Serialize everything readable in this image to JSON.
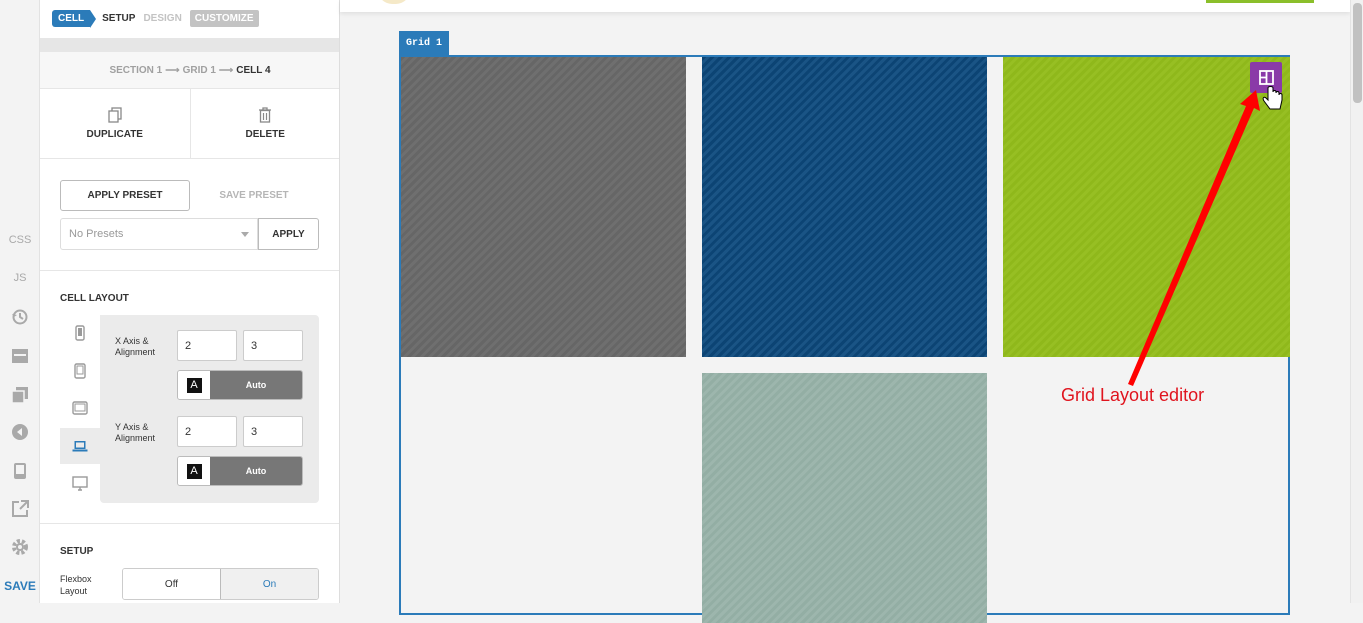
{
  "rail": {
    "css_label": "CSS",
    "js_label": "JS",
    "save_label": "SAVE",
    "icons": [
      "history-icon",
      "layout-icon",
      "pages-icon",
      "back-icon",
      "mobile-preview-icon",
      "external-link-icon",
      "gear-icon"
    ]
  },
  "panel": {
    "tabs": {
      "cell": "CELL",
      "setup": "SETUP",
      "design": "DESIGN",
      "customize": "CUSTOMIZE"
    },
    "breadcrumb": {
      "section": "SECTION 1",
      "grid": "GRID 1",
      "cell": "CELL 4",
      "arrow": "⟶"
    },
    "actions": {
      "duplicate": "DUPLICATE",
      "delete": "DELETE"
    },
    "presets": {
      "apply_preset": "APPLY PRESET",
      "save_preset": "SAVE PRESET",
      "select_value": "No Presets",
      "apply": "APPLY"
    },
    "cell_layout": {
      "title": "CELL LAYOUT",
      "x_label_line1": "X Axis &",
      "x_label_line2": "Alignment",
      "x_start": "2",
      "x_end": "3",
      "y_label_line1": "Y Axis &",
      "y_label_line2": "Alignment",
      "y_start": "2",
      "y_end": "3",
      "align_icon": "A",
      "align_value": "Auto",
      "active_device": "laptop"
    },
    "setup": {
      "title": "SETUP",
      "flexbox_line1": "Flexbox",
      "flexbox_line2": "Layout",
      "off": "Off",
      "on": "On",
      "selected": "On"
    }
  },
  "canvas": {
    "grid_tag": "Grid 1",
    "cell_colors": [
      "#666666",
      "#0c4474",
      "#8fb81b",
      "#93aea4"
    ],
    "annotation": "Grid Layout editor",
    "accent": "#2b7bb9",
    "button_color": "#8a3aa8",
    "annotation_color": "#e0141e"
  }
}
